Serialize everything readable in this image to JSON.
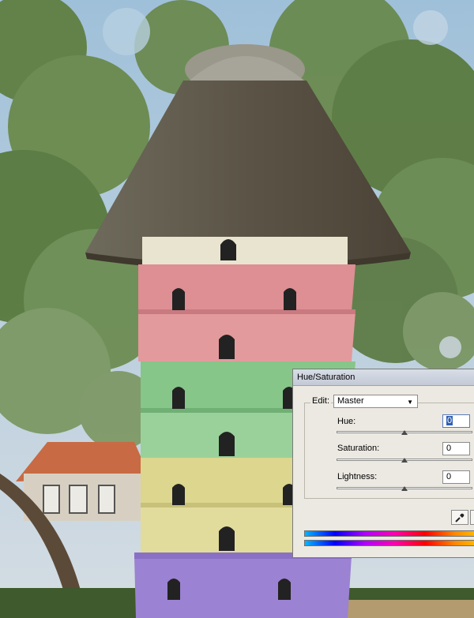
{
  "dialog": {
    "title": "Hue/Saturation",
    "edit_label": "Edit:",
    "edit_value": "Master",
    "hue": {
      "label": "Hue:",
      "value": "0"
    },
    "saturation": {
      "label": "Saturation:",
      "value": "0"
    },
    "lightness": {
      "label": "Lightness:",
      "value": "0"
    }
  },
  "scene": {
    "subject": "thatched dovecote tower",
    "band_colors": [
      "#dd8f93",
      "#86c689",
      "#dcd68e",
      "#9b82d2"
    ],
    "sky_color": "#a9c3d6",
    "foliage_color": "#5f7f43"
  },
  "icons": [
    "eyedropper-icon",
    "dropdown-arrow-icon"
  ]
}
